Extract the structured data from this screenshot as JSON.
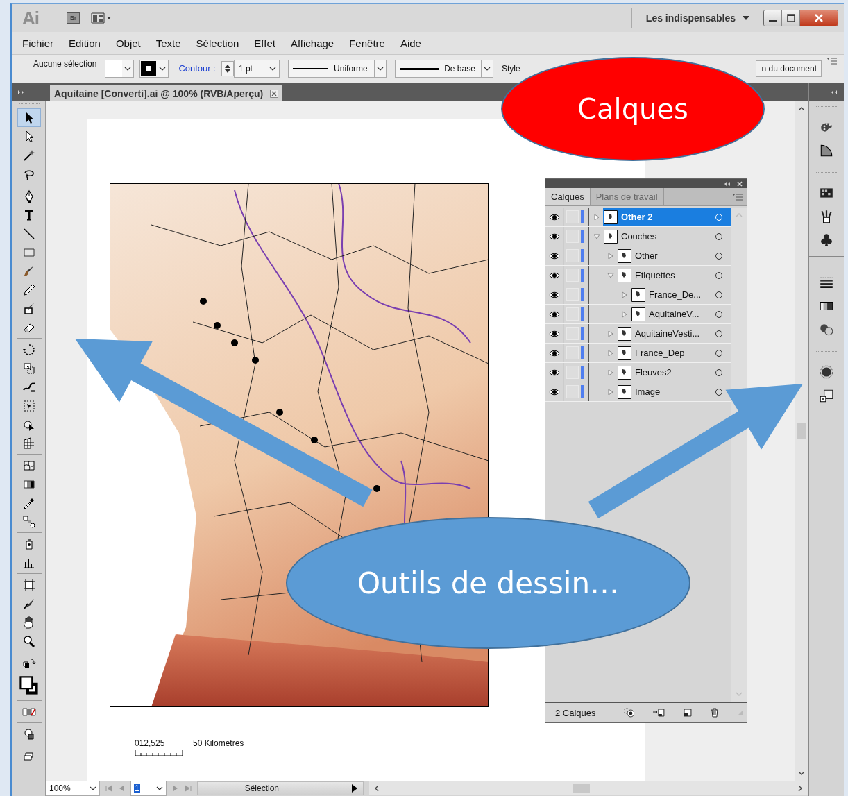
{
  "title_bar": {
    "app_logo": "Ai",
    "bridge_button": "Br",
    "workspace": "Les indispensables"
  },
  "menu": [
    {
      "label": "Fichier"
    },
    {
      "label": "Edition"
    },
    {
      "label": "Objet"
    },
    {
      "label": "Texte"
    },
    {
      "label": "Sélection"
    },
    {
      "label": "Effet"
    },
    {
      "label": "Affichage"
    },
    {
      "label": "Fenêtre"
    },
    {
      "label": "Aide"
    }
  ],
  "control_bar": {
    "selection_status": "Aucune sélection",
    "stroke_label": "Contour :",
    "stroke_weight": "1 pt",
    "stroke_profile": "Uniforme",
    "brush": "De base",
    "style_label": "Style",
    "document_button": "n du document"
  },
  "document_tab": {
    "title": "Aquitaine [Converti].ai @ 100% (RVB/Aperçu)"
  },
  "tools": [
    {
      "kind": "selection",
      "selected": true
    },
    {
      "kind": "direct-selection",
      "selected": false
    },
    {
      "kind": "magic-wand",
      "selected": false
    },
    {
      "kind": "lasso",
      "selected": false
    },
    {
      "kind": "pen",
      "selected": false
    },
    {
      "kind": "type",
      "selected": false
    },
    {
      "kind": "line",
      "selected": false
    },
    {
      "kind": "rectangle",
      "selected": false
    },
    {
      "kind": "paintbrush",
      "selected": false
    },
    {
      "kind": "pencil",
      "selected": false
    },
    {
      "kind": "blob-brush",
      "selected": false
    },
    {
      "kind": "eraser",
      "selected": false
    },
    {
      "kind": "rotate",
      "selected": false
    },
    {
      "kind": "scale",
      "selected": false
    },
    {
      "kind": "warp",
      "selected": false
    },
    {
      "kind": "free-transform",
      "selected": false
    },
    {
      "kind": "shape-builder",
      "selected": false
    },
    {
      "kind": "perspective",
      "selected": false
    },
    {
      "kind": "mesh",
      "selected": false
    },
    {
      "kind": "gradient",
      "selected": false
    },
    {
      "kind": "eyedropper",
      "selected": false
    },
    {
      "kind": "blend",
      "selected": false
    },
    {
      "kind": "symbol-sprayer",
      "selected": false
    },
    {
      "kind": "graph",
      "selected": false
    },
    {
      "kind": "artboard",
      "selected": false
    },
    {
      "kind": "slice",
      "selected": false
    },
    {
      "kind": "hand",
      "selected": false
    },
    {
      "kind": "zoom",
      "selected": false
    },
    {
      "kind": "swap",
      "selected": false
    },
    {
      "kind": "fill-stroke",
      "selected": false
    },
    {
      "kind": "color-modes",
      "selected": false
    },
    {
      "kind": "draw-mode",
      "selected": false
    },
    {
      "kind": "screen-mode",
      "selected": false
    }
  ],
  "artboard": {
    "scale_bar": {
      "ticks": "012,525",
      "unit": "50 Kilomètres"
    }
  },
  "layers_panel": {
    "tabs": [
      {
        "label": "Calques",
        "selected": true
      },
      {
        "label": "Plans de travail",
        "selected": false
      }
    ],
    "layers": [
      {
        "name": "Other 2",
        "visible": true,
        "expanded": false,
        "selected": true
      },
      {
        "name": "Couches",
        "visible": true,
        "expanded": true,
        "selected": false,
        "children": [
          {
            "name": "Other",
            "visible": true,
            "expanded": false,
            "selected": false
          },
          {
            "name": "Etiquettes",
            "visible": true,
            "expanded": true,
            "selected": false,
            "children": [
              {
                "name": "France_De...",
                "visible": true,
                "expanded": false,
                "selected": false
              },
              {
                "name": "AquitaineV...",
                "visible": true,
                "expanded": false,
                "selected": false
              }
            ]
          },
          {
            "name": "AquitaineVesti...",
            "visible": true,
            "expanded": false,
            "selected": false
          },
          {
            "name": "France_Dep",
            "visible": true,
            "expanded": false,
            "selected": false
          },
          {
            "name": "Fleuves2",
            "visible": true,
            "expanded": false,
            "selected": false
          },
          {
            "name": "Image",
            "visible": true,
            "expanded": false,
            "selected": false
          }
        ]
      }
    ],
    "footer": "2 Calques"
  },
  "status_bar": {
    "zoom": "100%",
    "artboard_number": "1",
    "info": "Sélection"
  },
  "callouts": [
    {
      "text": "Calques",
      "color": "#ff0000"
    },
    {
      "text": "Outils de dessin…",
      "color": "#5b9bd5"
    }
  ]
}
